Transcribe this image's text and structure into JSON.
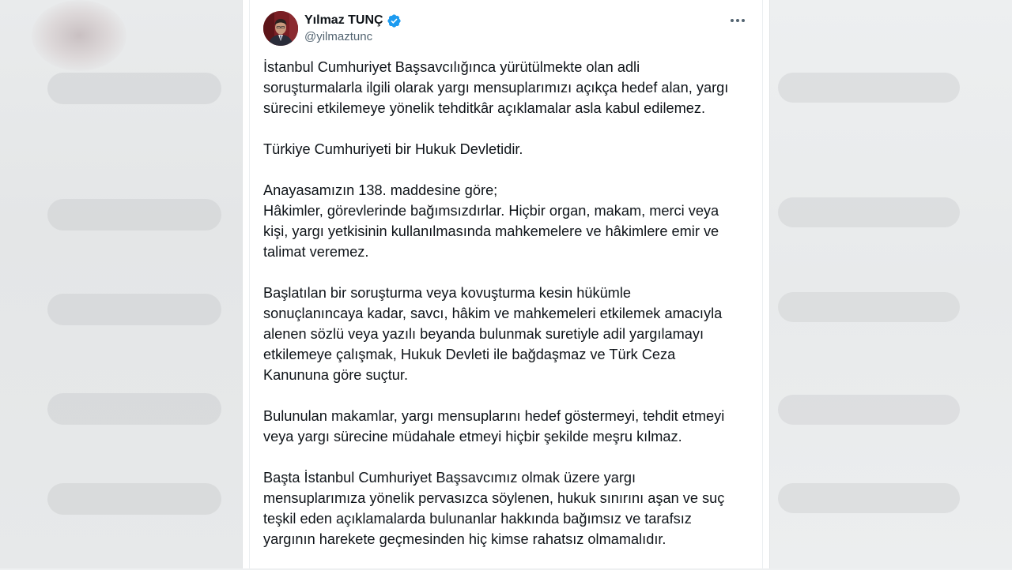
{
  "author": {
    "display_name": "Yılmaz TUNÇ",
    "handle": "@yilmaztunc",
    "verified": true,
    "verified_color": "#1d9bf0"
  },
  "post": {
    "paragraphs": [
      "İstanbul Cumhuriyet Başsavcılığınca yürütülmekte olan adli\nsoruşturmalarla ilgili olarak yargı mensuplarımızı açıkça hedef alan, yargı\nsürecini etkilemeye yönelik tehditkâr açıklamalar asla kabul edilemez.",
      "Türkiye Cumhuriyeti bir Hukuk Devletidir.",
      "Anayasamızın 138. maddesine göre;\nHâkimler, görevlerinde bağımsızdırlar. Hiçbir organ, makam, merci veya\nkişi, yargı yetkisinin kullanılmasında mahkemelere ve hâkimlere emir ve\ntalimat veremez.",
      "Başlatılan bir soruşturma veya kovuşturma kesin hükümle\nsonuçlanıncaya kadar, savcı, hâkim ve mahkemeleri etkilemek amacıyla\nalenen sözlü veya yazılı beyanda bulunmak suretiyle adil yargılamayı\netkilemeye çalışmak, Hukuk Devleti ile bağdaşmaz ve Türk Ceza\nKanununa göre suçtur.",
      "Bulunulan makamlar, yargı mensuplarını hedef göstermeyi, tehdit etmeyi\nveya yargı sürecine müdahale etmeyi hiçbir şekilde meşru kılmaz.",
      "Başta İstanbul Cumhuriyet Başsavcımız olmak üzere yargı\nmensuplarımıza yönelik pervasızca söylenen, hukuk sınırını aşan ve suç\nteşkil eden açıklamalarda bulunanlar hakkında bağımsız ve tarafsız\nyargının harekete geçmesinden hiç kimse rahatsız olmamalıdır."
    ]
  },
  "icons": {
    "verified": "verified-badge-icon",
    "more": "more-options-icon"
  }
}
